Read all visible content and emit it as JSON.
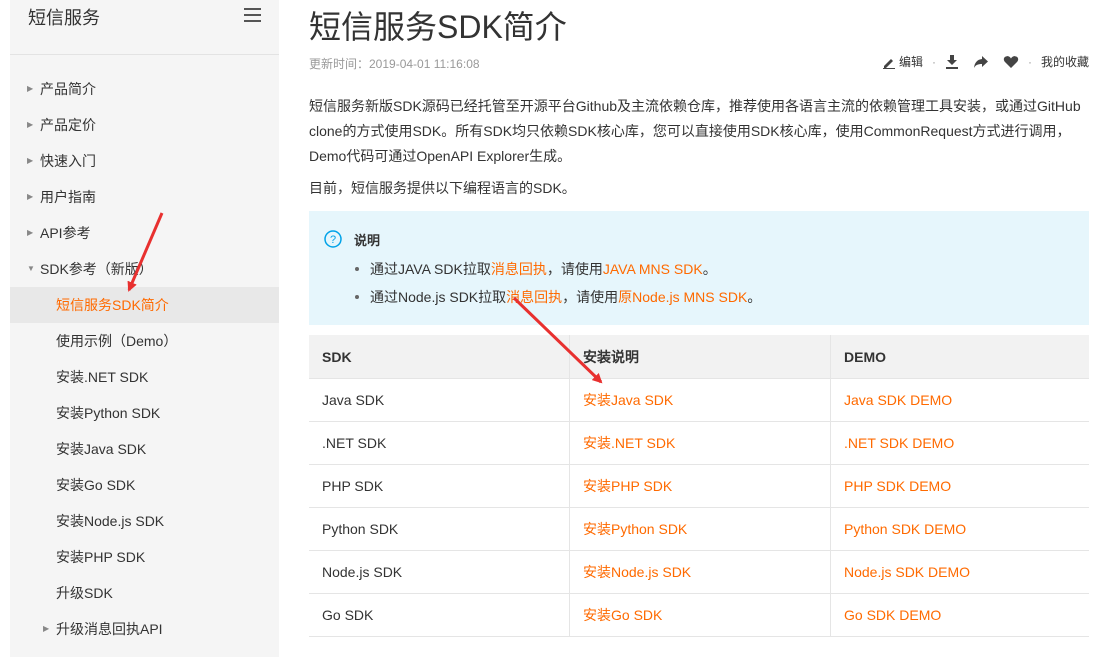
{
  "sidebar": {
    "title": "短信服务",
    "items": [
      {
        "label": "产品简介"
      },
      {
        "label": "产品定价"
      },
      {
        "label": "快速入门"
      },
      {
        "label": "用户指南"
      },
      {
        "label": "API参考"
      },
      {
        "label": "SDK参考（新版）"
      },
      {
        "label": "短信服务SDK简介"
      },
      {
        "label": "使用示例（Demo）"
      },
      {
        "label": "安装.NET SDK"
      },
      {
        "label": "安装Python SDK"
      },
      {
        "label": "安装Java SDK"
      },
      {
        "label": "安装Go SDK"
      },
      {
        "label": "安装Node.js SDK"
      },
      {
        "label": "安装PHP SDK"
      },
      {
        "label": "升级SDK"
      },
      {
        "label": "升级消息回执API"
      }
    ]
  },
  "main": {
    "title": "短信服务SDK简介",
    "updated": "更新时间：2019-04-01 11:16:08",
    "toolbar": {
      "edit": "编辑",
      "favorites": "我的收藏"
    },
    "intro": "短信服务新版SDK源码已经托管至开源平台Github及主流依赖仓库，推荐使用各语言主流的依赖管理工具安装，或通过GitHub clone的方式使用SDK。所有SDK均只依赖SDK核心库，您可以直接使用SDK核心库，使用CommonRequest方式进行调用，Demo代码可通过OpenAPI Explorer生成。",
    "lead": "目前，短信服务提供以下编程语言的SDK。",
    "note": {
      "title": "说明",
      "items": [
        {
          "pre": "通过JAVA SDK拉取",
          "link1": "消息回执",
          "mid": "，请使用",
          "link2": "JAVA MNS SDK",
          "post": "。"
        },
        {
          "pre": "通过Node.js SDK拉取",
          "link1": "消息回执",
          "mid": "，请使用",
          "link2": "原Node.js MNS SDK",
          "post": "。"
        }
      ]
    },
    "table": {
      "headers": [
        "SDK",
        "安装说明",
        "DEMO"
      ],
      "rows": [
        [
          "Java SDK",
          "安装Java SDK",
          "Java SDK DEMO"
        ],
        [
          ".NET SDK",
          "安装.NET SDK",
          ".NET SDK DEMO"
        ],
        [
          "PHP SDK",
          "安装PHP SDK",
          "PHP SDK DEMO"
        ],
        [
          "Python SDK",
          "安装Python SDK",
          "Python SDK DEMO"
        ],
        [
          "Node.js SDK",
          "安装Node.js SDK",
          "Node.js SDK DEMO"
        ],
        [
          "Go SDK",
          "安装Go SDK",
          "Go SDK DEMO"
        ]
      ]
    }
  },
  "colors": {
    "accent": "#ff6a00",
    "annotation": "#e8302f",
    "note_bg": "#e6f6fc"
  }
}
